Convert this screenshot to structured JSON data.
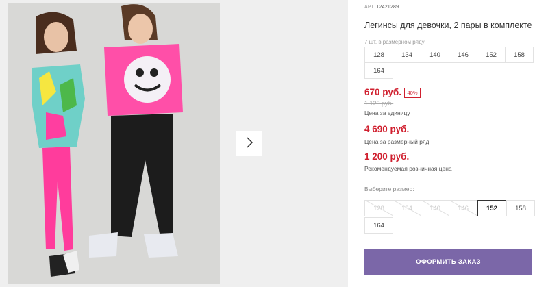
{
  "product": {
    "article_label": "АРТ.",
    "article_number": "12421289",
    "title": "Легинсы для девочки, 2 пары в комплекте"
  },
  "size_row": {
    "label": "7 шт. в размерном ряду",
    "sizes": [
      "128",
      "134",
      "140",
      "146",
      "152",
      "158",
      "164"
    ]
  },
  "pricing": {
    "unit_price": "670 руб.",
    "discount": "40%",
    "old_price": "1 120 руб.",
    "unit_price_note": "Цена за единицу",
    "row_price": "4 690 руб.",
    "row_price_note": "Цена за размерный ряд",
    "retail_price": "1 200 руб.",
    "retail_price_note": "Рекомендуемая розничная цена"
  },
  "size_picker": {
    "label": "Выберите размер:",
    "options": [
      {
        "value": "128",
        "available": false
      },
      {
        "value": "134",
        "available": false
      },
      {
        "value": "140",
        "available": false
      },
      {
        "value": "146",
        "available": false
      },
      {
        "value": "152",
        "available": true,
        "selected": true
      },
      {
        "value": "158",
        "available": true
      },
      {
        "value": "164",
        "available": true
      }
    ]
  },
  "gallery": {
    "next_icon": "chevron-right-icon"
  },
  "actions": {
    "order_label": "ОФОРМИТЬ ЗАКАЗ"
  },
  "colors": {
    "price_red": "#d0202f",
    "order_button": "#7b67a8"
  }
}
